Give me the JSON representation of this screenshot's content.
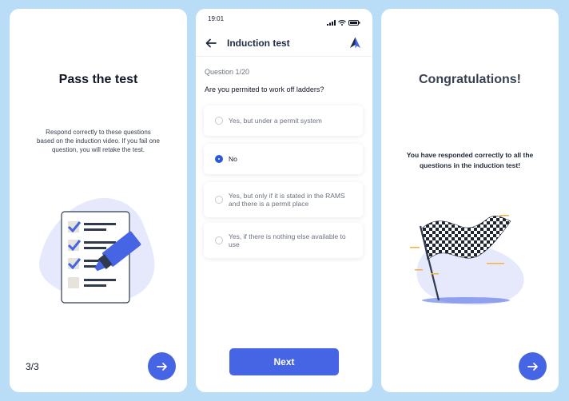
{
  "screens": {
    "left": {
      "title": "Pass the test",
      "description": "Respond correctly to these questions based on the induction video. If you fail one question, you will retake the test.",
      "page_indicator": "3/3",
      "next_icon": "arrow-right-icon"
    },
    "middle": {
      "status_time": "19:01",
      "status_icons": [
        "signal-icon",
        "wifi-icon",
        "battery-icon"
      ],
      "header": {
        "back_icon": "arrow-left-icon",
        "title": "Induction test",
        "logo_icon": "app-logo-icon"
      },
      "question_number": "Question 1/20",
      "question_text": "Are you permited to work off ladders?",
      "options": [
        {
          "label": "Yes, but under a permit system",
          "selected": false
        },
        {
          "label": "No",
          "selected": true
        },
        {
          "label": "Yes, but only if it is stated in the RAMS and there is a permit place",
          "selected": false
        },
        {
          "label": "Yes, if there is nothing else available to use",
          "selected": false
        }
      ],
      "next_label": "Next"
    },
    "right": {
      "title": "Congratulations!",
      "description": "You have responded correctly to all the questions in the induction test!",
      "next_icon": "arrow-right-icon"
    }
  },
  "colors": {
    "background": "#b9dcf7",
    "accent": "#4565e4",
    "selected_radio": "#2b5ad6"
  }
}
